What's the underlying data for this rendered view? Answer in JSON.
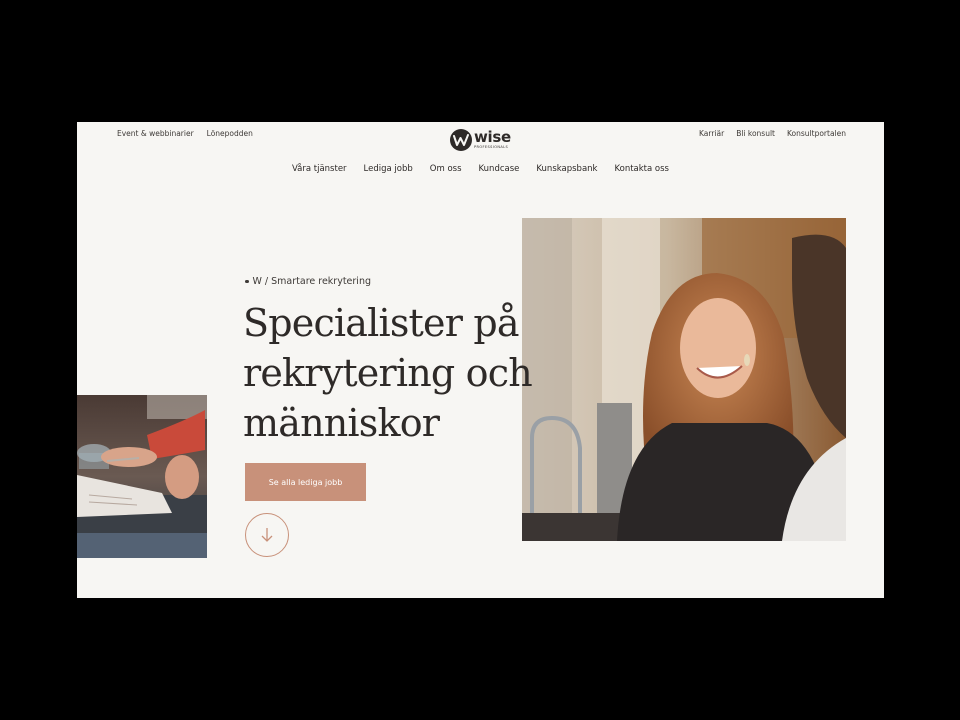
{
  "utility_nav": {
    "left": [
      "Event & webbinarier",
      "Lönepodden"
    ],
    "right": [
      "Karriär",
      "Bli konsult",
      "Konsultportalen"
    ]
  },
  "logo": {
    "word": "wise",
    "sub": "PROFESSIONALS"
  },
  "main_nav": [
    "Våra tjänster",
    "Lediga jobb",
    "Om oss",
    "Kundcase",
    "Kunskapsbank",
    "Kontakta oss"
  ],
  "hero": {
    "eyebrow": "W / Smartare rekrytering",
    "headline_lines": [
      "Specialister på",
      "rekrytering och",
      "människor"
    ],
    "cta_label": "Se alla lediga jobb"
  },
  "colors": {
    "background": "#f7f6f3",
    "accent": "#c8917a",
    "text": "#2e2a28",
    "frame": "#000000"
  },
  "icons": {
    "scroll": "arrow-down-icon"
  }
}
